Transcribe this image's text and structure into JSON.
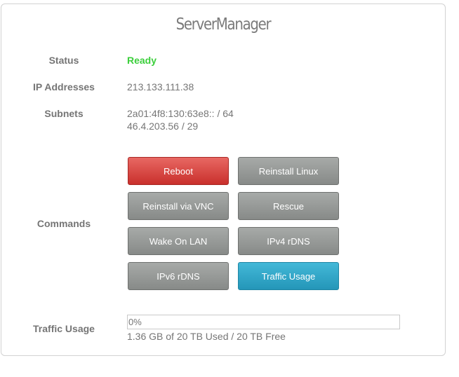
{
  "title": "ServerManager",
  "status": {
    "label": "Status",
    "value": "Ready",
    "color": "#3ccf3c"
  },
  "ip": {
    "label": "IP Addresses",
    "value": "213.133.111.38"
  },
  "subnets": {
    "label": "Subnets",
    "values": [
      "2a01:4f8:130:63e8:: / 64",
      "46.4.203.56 / 29"
    ]
  },
  "commands": {
    "label": "Commands",
    "buttons": [
      {
        "label": "Reboot",
        "style": "danger",
        "color": "#d9534f"
      },
      {
        "label": "Reinstall Linux",
        "style": "default",
        "color": "#959896"
      },
      {
        "label": "Reinstall via VNC",
        "style": "default",
        "color": "#959896"
      },
      {
        "label": "Rescue",
        "style": "default",
        "color": "#959896"
      },
      {
        "label": "Wake On LAN",
        "style": "default",
        "color": "#959896"
      },
      {
        "label": "IPv4 rDNS",
        "style": "default",
        "color": "#959896"
      },
      {
        "label": "IPv6 rDNS",
        "style": "default",
        "color": "#959896"
      },
      {
        "label": "Traffic Usage",
        "style": "info",
        "color": "#31a9cc"
      }
    ]
  },
  "traffic": {
    "label": "Traffic Usage",
    "percent_text": "0%",
    "percent_value": 0,
    "usage_text": "1.36 GB of 20 TB Used / 20 TB Free"
  }
}
